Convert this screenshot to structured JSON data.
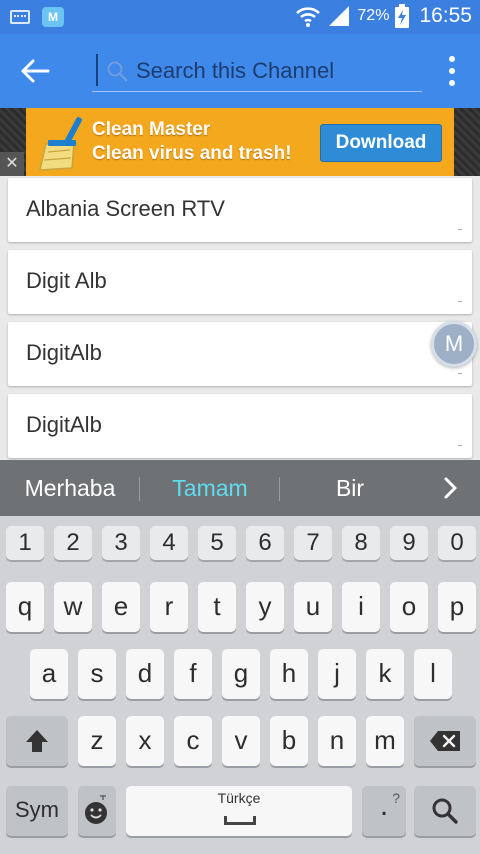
{
  "status_bar": {
    "battery": "72%",
    "time": "16:55",
    "app_badge": "M"
  },
  "app_bar": {
    "search_placeholder": "Search this Channel"
  },
  "ad": {
    "line1": "Clean Master",
    "line2": "Clean virus and trash!",
    "button": "Download",
    "close": "✕"
  },
  "channels": [
    "Albania Screen RTV",
    "Digit Alb",
    "DigitAlb",
    "DigitAlb"
  ],
  "floating_button": "M",
  "suggestions": [
    "Merhaba",
    "Tamam",
    "Bir"
  ],
  "colors": {
    "status_bar": "#3b7fe1",
    "app_bar": "#3e89ea",
    "highlight_suggestion": "#5fdcef",
    "ad_bg": "#f4a81d"
  },
  "keyboard": {
    "numbers": [
      "1",
      "2",
      "3",
      "4",
      "5",
      "6",
      "7",
      "8",
      "9",
      "0"
    ],
    "row1": [
      "q",
      "w",
      "e",
      "r",
      "t",
      "y",
      "u",
      "i",
      "o",
      "p"
    ],
    "row2": [
      "a",
      "s",
      "d",
      "f",
      "g",
      "h",
      "j",
      "k",
      "l"
    ],
    "row3": [
      "z",
      "x",
      "c",
      "v",
      "b",
      "n",
      "m"
    ],
    "sym": "Sym",
    "space_label": "Türkçe",
    "period": ".",
    "period_hint": "?"
  }
}
